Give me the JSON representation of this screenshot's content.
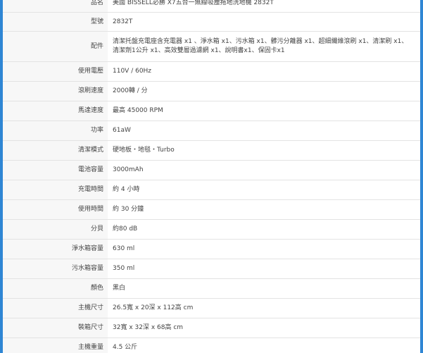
{
  "spec_table": {
    "rows": [
      {
        "label": "品名",
        "value": "美國 BISSELL必勝 X7五合一無線吸塵拖地洗地機 2832T"
      },
      {
        "label": "型號",
        "value": "2832T"
      },
      {
        "label": "配件",
        "value": "清潔托盤充電座含充電器 x1 、淨水箱 x1、污水箱 x1、髒污分離器 x1、超細纖維滾刷 x1、清潔刷 x1、清潔劑1公升 x1、高效雙層過濾網 x1、說明書x1、保固卡x1"
      },
      {
        "label": "使用電壓",
        "value": "110V / 60Hz"
      },
      {
        "label": "滾刷速度",
        "value": "2000轉 / 分"
      },
      {
        "label": "馬達速度",
        "value": "最高 45000 RPM"
      },
      {
        "label": "功率",
        "value": "61aW"
      },
      {
        "label": "清潔模式",
        "value": "硬地板・地毯・Turbo"
      },
      {
        "label": "電池容量",
        "value": "3000mAh"
      },
      {
        "label": "充電時間",
        "value": "約 4 小時"
      },
      {
        "label": "使用時間",
        "value": "約 30 分鐘"
      },
      {
        "label": "分貝",
        "value": "約80 dB"
      },
      {
        "label": "淨水箱容量",
        "value": "630 ml"
      },
      {
        "label": "污水箱容量",
        "value": "350 ml"
      },
      {
        "label": "顏色",
        "value": "黑白"
      },
      {
        "label": "主機尺寸",
        "value": "26.5寬 x 20深 x 112高 cm"
      },
      {
        "label": "裝箱尺寸",
        "value": "32寬 x 32深 x 68高 cm"
      },
      {
        "label": "主機重量",
        "value": "4.5 公斤"
      }
    ]
  },
  "colors": {
    "side_bar": "#2f86d4",
    "label_bg": "#f7f7f7",
    "divider": "#e3e3e3"
  }
}
